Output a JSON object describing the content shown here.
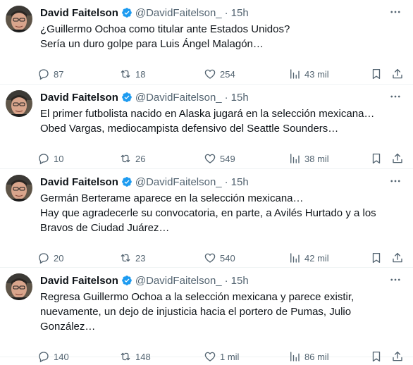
{
  "tweets": [
    {
      "author_name": "David Faitelson",
      "handle": "@DavidFaitelson_",
      "separator": "·",
      "time": "15h",
      "lines": [
        "¿Guillermo Ochoa como titular ante Estados Unidos?",
        "Sería un duro golpe para Luis Ángel Malagón…"
      ],
      "replies": "87",
      "retweets": "18",
      "likes": "254",
      "views": "43 mil"
    },
    {
      "author_name": "David Faitelson",
      "handle": "@DavidFaitelson_",
      "separator": "·",
      "time": "15h",
      "lines": [
        "El primer futbolista nacido en Alaska jugará en la selección mexicana…",
        "Obed Vargas, mediocampista defensivo del Seattle Sounders…"
      ],
      "replies": "10",
      "retweets": "26",
      "likes": "549",
      "views": "38 mil"
    },
    {
      "author_name": "David Faitelson",
      "handle": "@DavidFaitelson_",
      "separator": "·",
      "time": "15h",
      "lines": [
        "Germán Berterame aparece en la selección mexicana…",
        "Hay que agradecerle su convocatoria, en parte, a Avilés Hurtado y a los",
        "Bravos de Ciudad Juárez…"
      ],
      "replies": "20",
      "retweets": "23",
      "likes": "540",
      "views": "42 mil"
    },
    {
      "author_name": "David Faitelson",
      "handle": "@DavidFaitelson_",
      "separator": "·",
      "time": "15h",
      "lines": [
        "Regresa Guillermo Ochoa a la selección mexicana y parece existir,",
        "nuevamente, un dejo de injusticia hacia el portero de Pumas, Julio",
        "González…"
      ],
      "replies": "140",
      "retweets": "148",
      "likes": "1 mil",
      "views": "86 mil"
    }
  ],
  "colors": {
    "verified": "#1d9bf0",
    "muted": "#536471",
    "text": "#0f1419"
  }
}
